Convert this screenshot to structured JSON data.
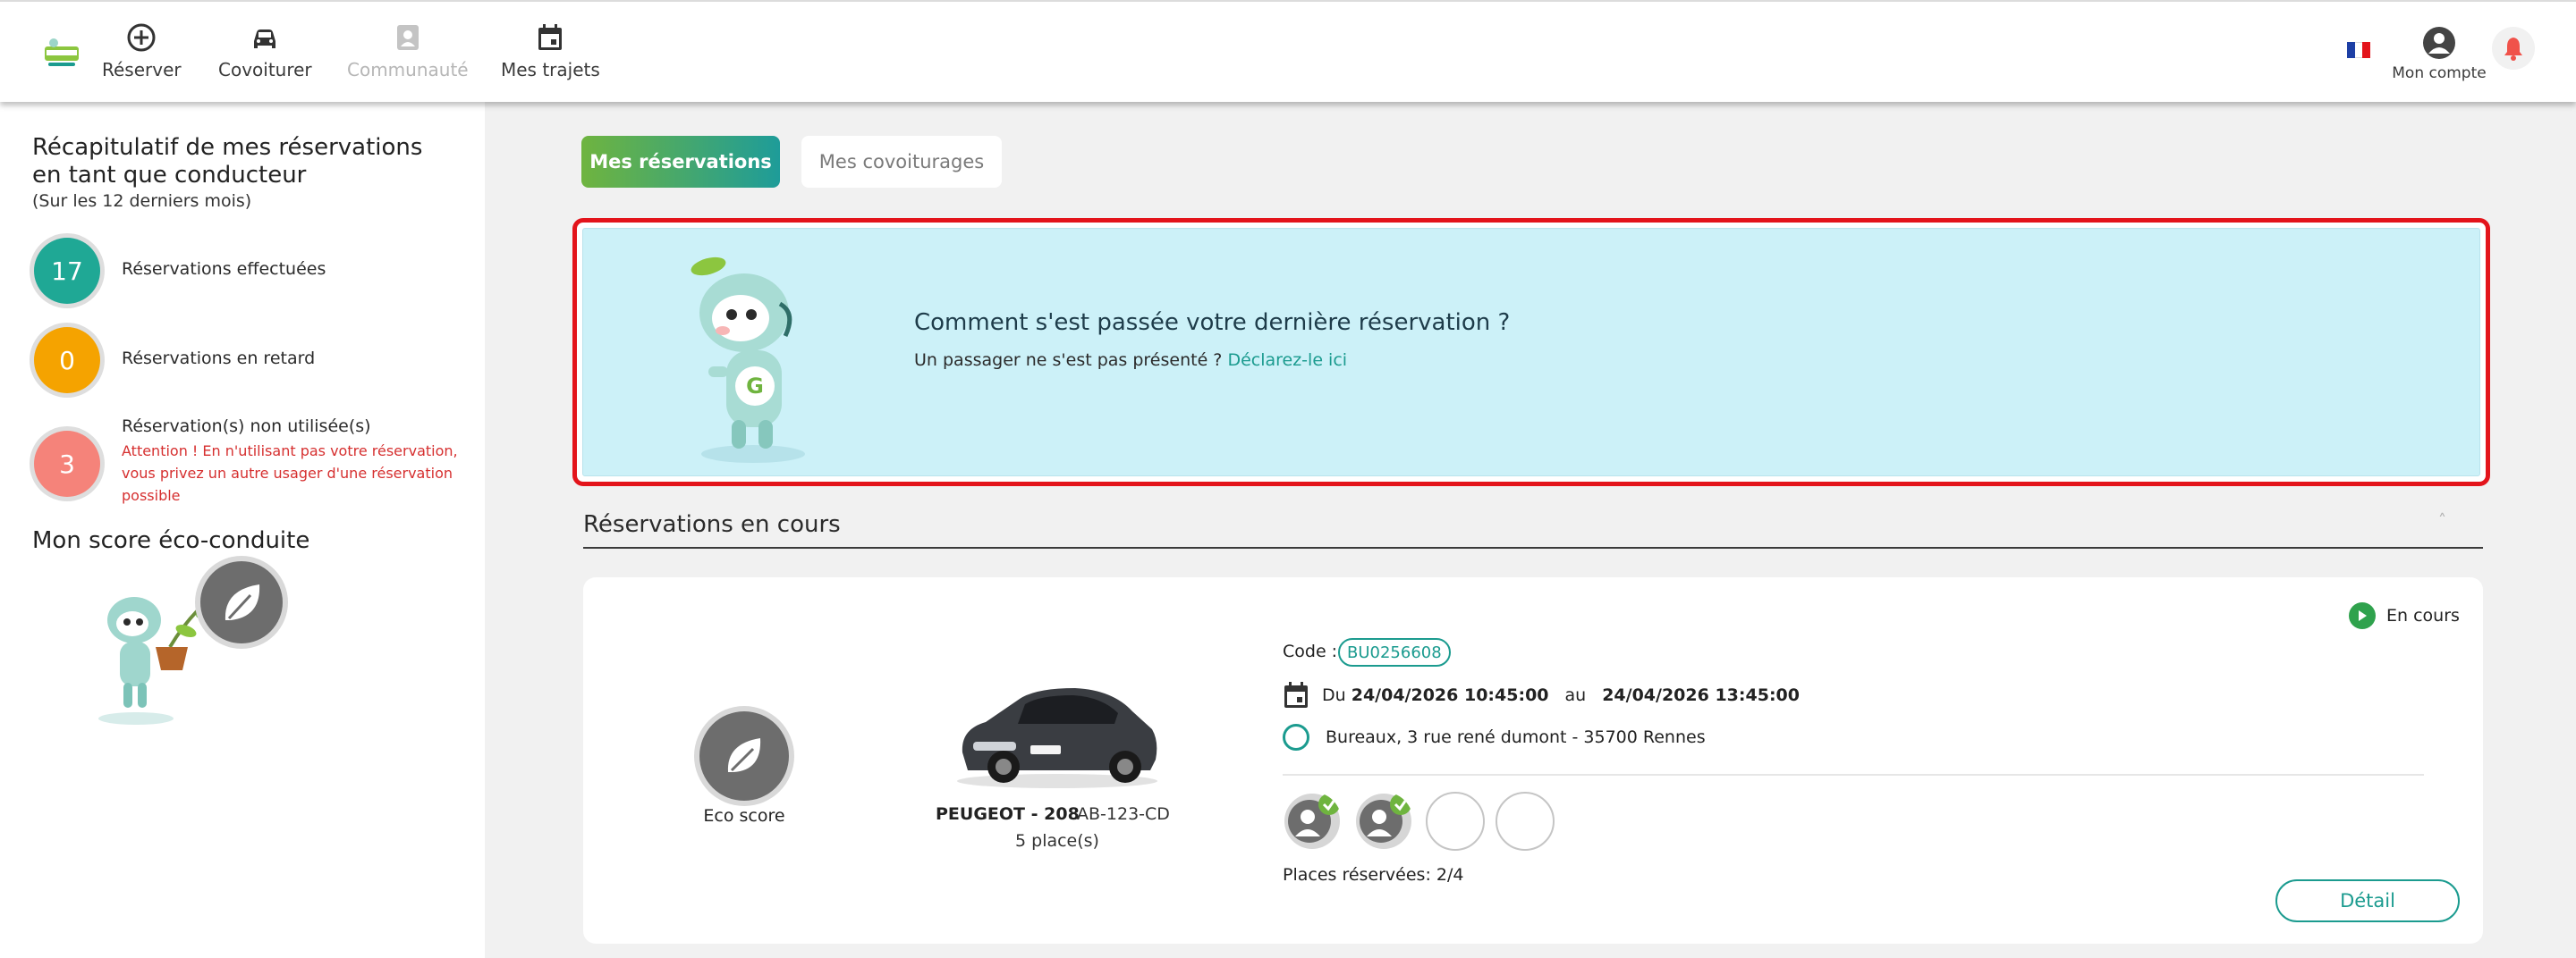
{
  "nav": {
    "items": [
      {
        "label": "Réserver",
        "icon": "plus-circle-icon"
      },
      {
        "label": "Covoiturer",
        "icon": "car-icon"
      },
      {
        "label": "Communauté",
        "icon": "community-icon",
        "disabled": true
      },
      {
        "label": "Mes trajets",
        "icon": "calendar-icon"
      }
    ],
    "account_label": "Mon compte"
  },
  "sidebar": {
    "title": "Récapitulatif de mes réservations en tant que conducteur",
    "subtitle": "(Sur les 12 derniers mois)",
    "stats": [
      {
        "value": "17",
        "label": "Réservations effectuées",
        "color": "#1fa895"
      },
      {
        "value": "0",
        "label": "Réservations en retard",
        "color": "#f5a300"
      },
      {
        "value": "3",
        "label": "Réservation(s) non utilisée(s)",
        "color": "#f5837a"
      }
    ],
    "warning": "Attention ! En n'utilisant pas votre réservation, vous privez un autre usager d'une réservation possible",
    "eco_title": "Mon score éco-conduite"
  },
  "tabs": {
    "active": "Mes réservations",
    "inactive": "Mes covoiturages"
  },
  "banner": {
    "question": "Comment s'est passée votre dernière réservation ?",
    "prompt": "Un passager ne s'est pas présenté ?",
    "link": "Déclarez-le ici"
  },
  "section": {
    "title": "Réservations en cours",
    "caret": "˄"
  },
  "reservation": {
    "status": "En cours",
    "eco_label": "Eco score",
    "car_model": "PEUGEOT - 208",
    "plate": "AB-123-CD",
    "seats": "5 place(s)",
    "code_label": "Code :",
    "code": "BU0256608",
    "date_from_prefix": "Du",
    "date_from": "24/04/2026 10:45:00",
    "date_sep": "au",
    "date_to": "24/04/2026 13:45:00",
    "address": "Bureaux, 3 rue rené dumont - 35700 Rennes",
    "booked_label": "Places réservées: 2/4",
    "detail_button": "Détail"
  },
  "colors": {
    "accent": "#1b9b8f",
    "green": "#6fb43f",
    "alert": "#e3141b",
    "banner_bg": "#ccf1f8"
  }
}
